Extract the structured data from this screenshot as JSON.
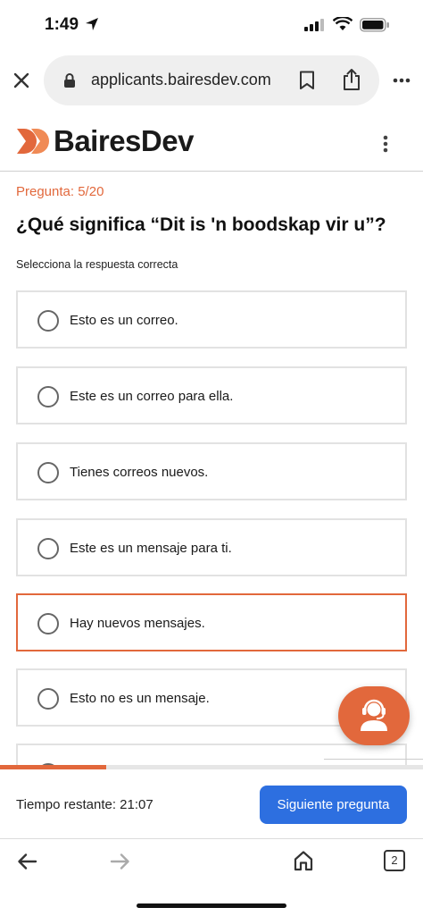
{
  "status_bar": {
    "time": "1:49"
  },
  "browser": {
    "url": "applicants.bairesdev.com",
    "tab_count": "2"
  },
  "site": {
    "brand": "BairesDev"
  },
  "question": {
    "counter": "Pregunta: 5/20",
    "title": "¿Qué significa “Dit is 'n boodskap vir u”?",
    "instruction": "Selecciona la respuesta correcta",
    "options": [
      {
        "label": "Esto es un correo.",
        "selected": false
      },
      {
        "label": "Este es un correo para ella.",
        "selected": false
      },
      {
        "label": "Tienes correos nuevos.",
        "selected": false
      },
      {
        "label": "Este es un mensaje para ti.",
        "selected": false
      },
      {
        "label": "Hay nuevos mensajes.",
        "selected": true
      },
      {
        "label": "Esto no es un mensaje.",
        "selected": false
      }
    ]
  },
  "progress": {
    "fraction": 0.25
  },
  "footer": {
    "timer": "Tiempo restante: 21:07",
    "next_label": "Siguiente pregunta"
  },
  "colors": {
    "accent": "#e2683c",
    "primary_button": "#2d6fe0"
  },
  "icons": [
    "location-arrow-icon",
    "signal-icon",
    "wifi-icon",
    "battery-icon",
    "close-icon",
    "lock-icon",
    "bookmark-icon",
    "share-icon",
    "more-icon",
    "logo-icon",
    "kebab-menu-icon",
    "support-agent-icon",
    "back-arrow-icon",
    "forward-arrow-icon",
    "home-icon"
  ]
}
